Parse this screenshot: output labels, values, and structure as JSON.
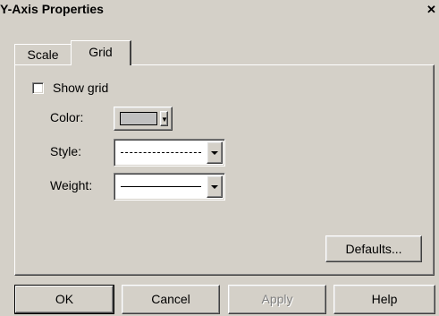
{
  "window": {
    "title": "Y-Axis Properties",
    "close_glyph": "✕"
  },
  "tabs": [
    {
      "label": "Scale"
    },
    {
      "label": "Grid",
      "selected": true
    }
  ],
  "grid": {
    "show_grid_label": "Show grid",
    "show_grid_checked": false,
    "color_label": "Color:",
    "color_value": "#c0c0c0",
    "style_label": "Style:",
    "style_value": "dashed",
    "weight_label": "Weight:",
    "weight_value": "thin solid",
    "defaults_label": "Defaults..."
  },
  "buttons": {
    "ok": "OK",
    "cancel": "Cancel",
    "apply": "Apply",
    "help": "Help"
  }
}
